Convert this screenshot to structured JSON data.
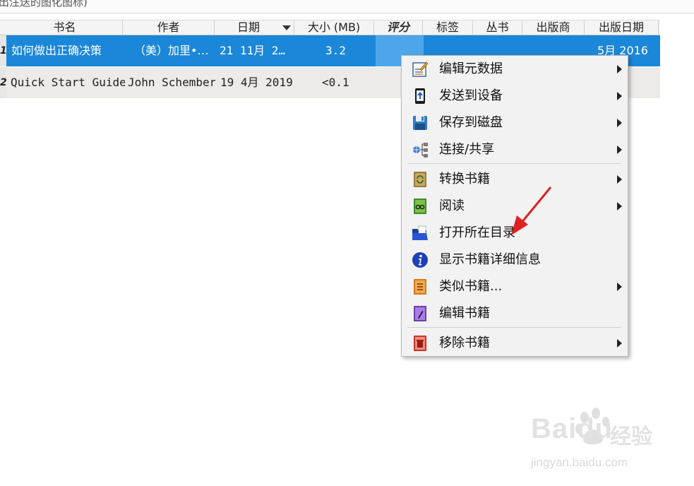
{
  "toolbar_fragment": "出注送的图化图标)",
  "columns": [
    {
      "label": "书名"
    },
    {
      "label": "作者"
    },
    {
      "label": "日期"
    },
    {
      "label": "大小 (MB)"
    },
    {
      "label": "评分"
    },
    {
      "label": "标签"
    },
    {
      "label": "丛书"
    },
    {
      "label": "出版商"
    },
    {
      "label": "出版日期"
    }
  ],
  "rows": [
    {
      "num": "1",
      "title": "如何做出正确决策",
      "author": "（美）加里•…",
      "date": "21 11月 2…",
      "size": "3.2",
      "pubdate": "5月 2016"
    },
    {
      "num": "2",
      "title": "Quick Start Guide",
      "author": "John Schember",
      "date": "19 4月 2019",
      "size": "<0.1",
      "pubdate": ""
    }
  ],
  "context_menu": {
    "items": [
      {
        "label": "编辑元数据",
        "icon": "edit-metadata-icon",
        "submenu": true
      },
      {
        "label": "发送到设备",
        "icon": "send-to-device-icon",
        "submenu": true
      },
      {
        "label": "保存到磁盘",
        "icon": "save-disk-icon",
        "submenu": true
      },
      {
        "label": "连接/共享",
        "icon": "connect-share-icon",
        "submenu": true
      },
      {
        "label": "转换书籍",
        "icon": "convert-book-icon",
        "submenu": true
      },
      {
        "label": "阅读",
        "icon": "read-book-icon",
        "submenu": true
      },
      {
        "label": "打开所在目录",
        "icon": "open-folder-icon",
        "submenu": false
      },
      {
        "label": "显示书籍详细信息",
        "icon": "info-icon",
        "submenu": false
      },
      {
        "label": "类似书籍...",
        "icon": "similar-books-icon",
        "submenu": true
      },
      {
        "label": "编辑书籍",
        "icon": "edit-book-icon",
        "submenu": false
      },
      {
        "label": "移除书籍",
        "icon": "remove-book-icon",
        "submenu": true
      }
    ]
  },
  "watermark": {
    "brand": "Baidu",
    "cn": "经验",
    "url": "jingyan.baidu.com"
  },
  "colors": {
    "selection": "#1b87d8",
    "annotation_arrow": "#e02020"
  }
}
